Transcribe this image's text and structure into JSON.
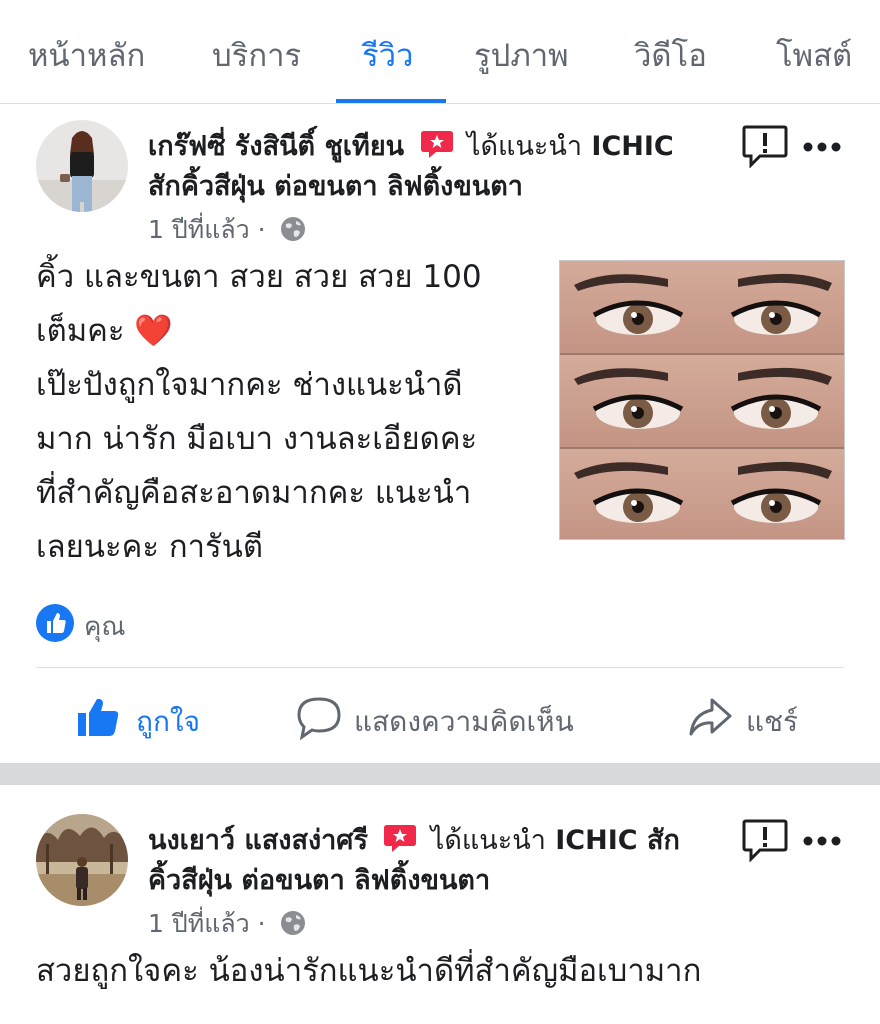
{
  "tabs": {
    "items": [
      {
        "label": "หน้าหลัก",
        "active": false
      },
      {
        "label": "บริการ",
        "active": false
      },
      {
        "label": "รีวิว",
        "active": true
      },
      {
        "label": "รูปภาพ",
        "active": false
      },
      {
        "label": "วิดีโอ",
        "active": false
      },
      {
        "label": "โพสต์",
        "active": false
      }
    ]
  },
  "colors": {
    "accent": "#1877f2",
    "recommend_badge": "#f02849",
    "heart": "#e02424",
    "secondary_text": "#606770"
  },
  "posts": [
    {
      "author": "เกร๊ฟซี่ รังสินีติ์ ชูเทียน",
      "action": "ได้แนะนำ",
      "page_line1": "ICHIC",
      "page_line2": "สักคิ้วสีฝุ่น ต่อขนตา ลิฟติ้งขนตา",
      "timestamp": "1 ปีที่แล้ว ·",
      "body_line1": "คิ้ว และขนตา สวย สวย สวย 100",
      "body_line2": "เต็มคะ",
      "body_line2_emoji": "❤️",
      "body_line3": "เป๊ะปังถูกใจมากคะ ช่างแนะนำดี",
      "body_line4": "มาก น่ารัก มือเบา งานละเอียดคะ",
      "body_line5": "ที่สำคัญคือสะอาดมากคะ แนะนำ",
      "body_line6": "เลยนะคะ การันตี",
      "reactions": "คุณ",
      "actions": {
        "like": "ถูกใจ",
        "comment": "แสดงความคิดเห็น",
        "share": "แชร์"
      },
      "icons": [
        "recommend-badge-icon",
        "globe-icon",
        "report-icon",
        "more-icon",
        "like-icon",
        "comment-icon",
        "share-icon"
      ]
    },
    {
      "author": "นงเยาว์ แสงสง่าศรี",
      "action": "ได้แนะนำ",
      "page_line1": "ICHIC สัก",
      "page_line2": "คิ้วสีฝุ่น ต่อขนตา ลิฟติ้งขนตา",
      "timestamp": "1 ปีที่แล้ว ·",
      "body_line1": "สวยถูกใจคะ น้องน่ารักแนะนำดีที่สำคัญมือเบามาก"
    }
  ]
}
